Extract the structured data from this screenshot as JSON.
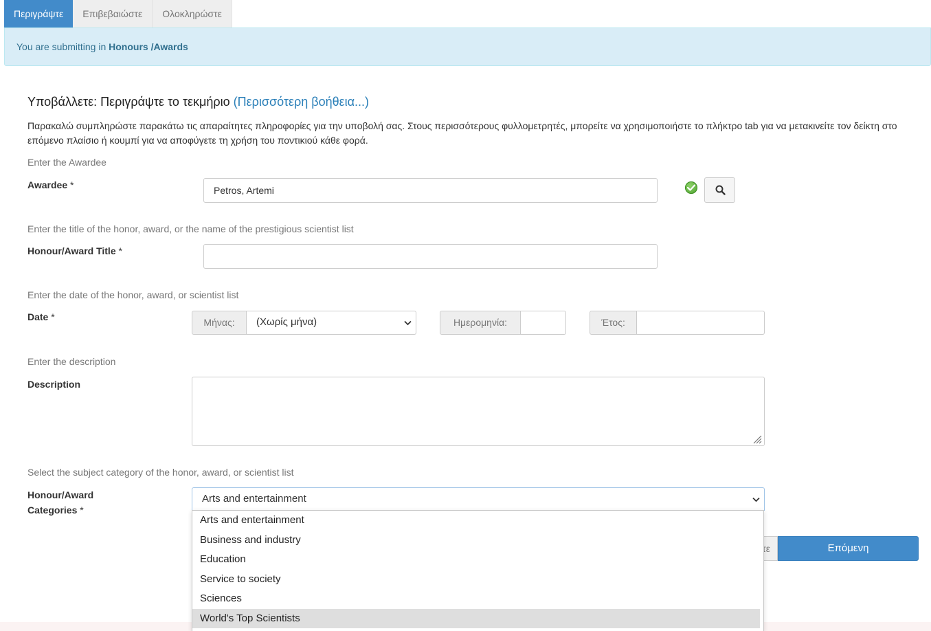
{
  "tabs": [
    {
      "label": "Περιγράψτε",
      "active": true
    },
    {
      "label": "Επιβεβαιώστε",
      "active": false
    },
    {
      "label": "Ολοκληρώστε",
      "active": false
    }
  ],
  "alert": {
    "prefix": "You are submitting in",
    "collection": "Honours /Awards"
  },
  "heading": {
    "text": "Υποβάλλετε: Περιγράψτε το τεκμήριο",
    "help_link": "(Περισσότερη βοήθεια...)"
  },
  "intro": "Παρακαλώ συμπληρώστε παρακάτω τις απαραίτητες πληροφορίες για την υποβολή σας. Στους περισσότερους φυλλομετρητές, μπορείτε να χρησιμοποιήστε το πλήκτρο tab για να μετακινείτε τον δείκτη στο επόμενο πλαίσιο ή κουμπί για να αποφύγετε τη χρήση του ποντικιού κάθε φορά.",
  "required_marker": "*",
  "awardee": {
    "hint": "Enter the Awardee",
    "label": "Awardee",
    "value": "Petros, Artemi"
  },
  "title": {
    "hint": "Enter the title of the honor, award, or the name of the prestigious scientist list",
    "label": "Honour/Award Title",
    "value": ""
  },
  "date": {
    "hint": "Enter the date of the honor, award, or scientist list",
    "label": "Date",
    "month_label": "Μήνας:",
    "month_value": "(Χωρίς μήνα)",
    "day_label": "Ημερομηνία:",
    "day_value": "",
    "year_label": "Έτος:",
    "year_value": ""
  },
  "description": {
    "hint": "Enter the description",
    "label": "Description",
    "value": ""
  },
  "category": {
    "hint": "Select the subject category of the honor, award, or scientist list",
    "label_line1": "Honour/Award",
    "label_line2": "Categories",
    "selected": "Arts and entertainment",
    "options": [
      "Arts and entertainment",
      "Business and industry",
      "Education",
      "Service to society",
      "Sciences",
      "World's Top Scientists"
    ],
    "highlighted_index": 5
  },
  "buttons": {
    "prev_partial": "τε",
    "next": "Επόμενη"
  },
  "icons": {
    "valid": "check-circle-icon",
    "search": "search-icon",
    "select": "chevron-down-icon",
    "resize": "resize-handle-icon"
  },
  "colors": {
    "primary": "#428bca",
    "alert_bg": "#d9edf7",
    "alert_text": "#31708f",
    "link": "#2a7fb8"
  }
}
